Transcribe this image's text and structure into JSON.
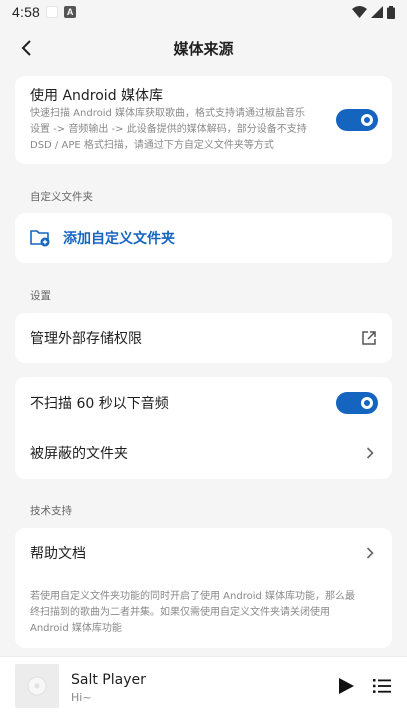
{
  "status_bar": {
    "time": "4:58",
    "a_icon": "A"
  },
  "header": {
    "title": "媒体来源"
  },
  "android_lib": {
    "title": "使用 Android 媒体库",
    "desc_lines": [
      "快速扫描 Android 媒体库获取歌曲，格式支持请通过椒盐音乐",
      "设置 -> 音频输出 -> 此设备提供的媒体解码，部分设备不支持",
      "DSD / APE 格式扫描，请通过下方自定义文件夹等方式"
    ],
    "enabled": true
  },
  "custom_folder": {
    "section_label": "自定义文件夹",
    "add_label": "添加自定义文件夹"
  },
  "settings": {
    "section_label": "设置",
    "manage_storage": "管理外部存储权限",
    "skip_short": "不扫描 60 秒以下音频",
    "skip_short_enabled": true,
    "blocked_folders": "被屏蔽的文件夹"
  },
  "support": {
    "section_label": "技术支持",
    "help_docs": "帮助文档",
    "note_lines": [
      "若使用自定义文件夹功能的同时开启了使用 Android 媒体库功能，那么最",
      "终扫描到的歌曲为二者并集。如果仅需使用自定义文件夹请关闭使用",
      "Android 媒体库功能"
    ]
  },
  "player": {
    "title": "Salt Player",
    "subtitle": "Hi~"
  },
  "colors": {
    "accent": "#1565c0",
    "background": "#f5f5f5",
    "card": "#ffffff"
  }
}
